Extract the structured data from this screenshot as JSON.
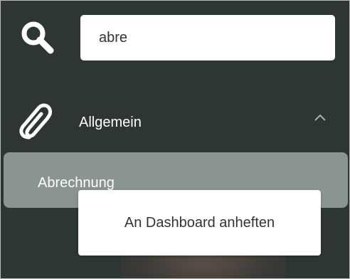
{
  "search": {
    "value": "abre",
    "icon": "search-icon"
  },
  "nav": {
    "section": {
      "label": "Allgemein",
      "icon": "paperclip-icon",
      "expanded": true
    },
    "items": [
      {
        "label": "Abrechnung",
        "highlighted": true
      }
    ]
  },
  "context_menu": {
    "items": [
      {
        "label": "An Dashboard anheften"
      }
    ]
  },
  "colors": {
    "background": "#2d3633",
    "highlight": "#8b958f",
    "text_light": "#ffffff",
    "text_dark": "#333333"
  }
}
